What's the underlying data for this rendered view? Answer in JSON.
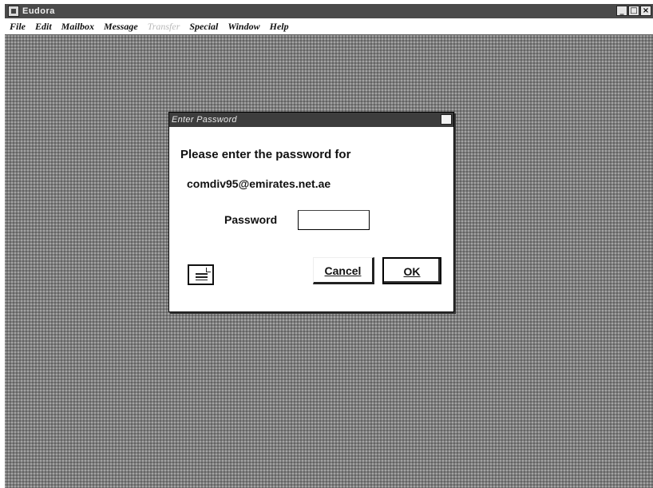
{
  "app": {
    "title": "Eudora",
    "controls": [
      "_",
      "□",
      "×"
    ]
  },
  "menubar": {
    "items": [
      {
        "label": "File",
        "enabled": true
      },
      {
        "label": "Edit",
        "enabled": true
      },
      {
        "label": "Mailbox",
        "enabled": true
      },
      {
        "label": "Message",
        "enabled": true
      },
      {
        "label": "Transfer",
        "enabled": false
      },
      {
        "label": "Special",
        "enabled": true
      },
      {
        "label": "Window",
        "enabled": true
      },
      {
        "label": "Help",
        "enabled": true
      }
    ]
  },
  "dialog": {
    "title": "Enter Password",
    "prompt": "Please enter the password for",
    "account": "comdiv95@emirates.net.ae",
    "password_label": "Password",
    "password_value": "",
    "cancel_label": "Cancel",
    "ok_label": "OK"
  },
  "icons": {
    "app": "eudora-app-icon",
    "help": "help-document-icon",
    "close": "close-icon"
  },
  "colors": {
    "desktop": "#7e7e7e",
    "titlebar": "#4a4a4a",
    "dialog_bg": "#ffffff"
  }
}
